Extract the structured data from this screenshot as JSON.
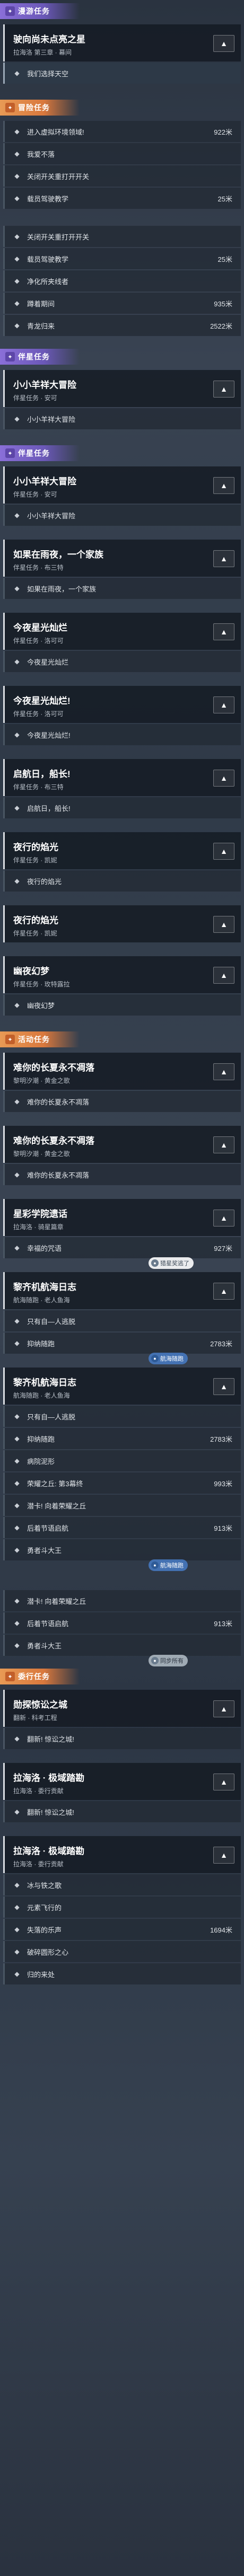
{
  "sections": [
    {
      "type": "section",
      "label": "漫游任务",
      "style": "purple"
    },
    {
      "type": "quest",
      "title": "驶向尚未点亮之星",
      "subtitle": "拉海洛 第三章 · 幕间",
      "sub_rows": [
        {
          "text": "我们选择天空",
          "value": "",
          "state": "sel"
        }
      ]
    },
    {
      "type": "section",
      "label": "冒险任务",
      "style": "orange"
    },
    {
      "type": "rows",
      "items": [
        {
          "text": "进入虚拟环境领域!",
          "value": "922米",
          "state": ""
        },
        {
          "text": "我爱不落",
          "value": "",
          "state": ""
        },
        {
          "text": "关闭开关重打开开关",
          "value": "",
          "state": ""
        },
        {
          "text": "载员驾驶教学",
          "value": "25米",
          "state": ""
        },
        {
          "text": "关闭开关重打开开关",
          "value": "",
          "state": "gap"
        },
        {
          "text": "载员驾驶教学",
          "value": "25米",
          "state": ""
        },
        {
          "text": "净化所夹线者",
          "value": "",
          "state": ""
        },
        {
          "text": "蹲着期间",
          "value": "935米",
          "state": ""
        },
        {
          "text": "青龙归来",
          "value": "2522米",
          "state": ""
        }
      ]
    },
    {
      "type": "section",
      "label": "伴星任务",
      "style": "purple"
    },
    {
      "type": "quest",
      "title": "小小羊祥大冒险",
      "subtitle": "伴星任务 · 安可",
      "sub_rows": [
        {
          "text": "小小羊祥大冒险",
          "value": "",
          "state": ""
        }
      ]
    },
    {
      "type": "section",
      "label": "伴星任务",
      "style": "purple"
    },
    {
      "type": "quest",
      "title": "小小羊祥大冒险",
      "subtitle": "伴星任务 · 安可",
      "sub_rows": [
        {
          "text": "小小羊祥大冒险",
          "value": "",
          "state": ""
        }
      ]
    },
    {
      "type": "quest",
      "title": "如果在雨夜，一个家族",
      "subtitle": "伴星任务 · 布三特",
      "sub_rows": [
        {
          "text": "如果在雨夜，一个家族",
          "value": "",
          "state": ""
        }
      ]
    },
    {
      "type": "quest",
      "title": "今夜星光灿烂",
      "subtitle": "伴星任务 · 洛可可",
      "sub_rows": [
        {
          "text": "今夜星光灿烂",
          "value": "",
          "state": ""
        }
      ]
    },
    {
      "type": "quest",
      "title": "今夜星光灿烂!",
      "subtitle": "伴星任务 · 洛可可",
      "sub_rows": [
        {
          "text": "今夜星光灿烂!",
          "value": "",
          "state": ""
        }
      ]
    },
    {
      "type": "quest",
      "title": "启航日，船长!",
      "subtitle": "伴星任务 · 布三特",
      "sub_rows": [
        {
          "text": "启航日，船长!",
          "value": "",
          "state": ""
        }
      ]
    },
    {
      "type": "quest",
      "title": "夜行的焰光",
      "subtitle": "伴星任务 · 凯妮",
      "sub_rows": [
        {
          "text": "夜行的焰光",
          "value": "",
          "state": ""
        }
      ]
    },
    {
      "type": "quest",
      "title": "夜行的焰光",
      "subtitle": "伴星任务 · 凯妮",
      "sub_rows": []
    },
    {
      "type": "quest",
      "title": "幽夜幻梦",
      "subtitle": "伴星任务 · 玫特露拉",
      "sub_rows": [
        {
          "text": "幽夜幻梦",
          "value": "",
          "state": ""
        }
      ]
    },
    {
      "type": "section",
      "label": "活动任务",
      "style": "orange"
    },
    {
      "type": "quest",
      "title": "难你的长夏永不凋落",
      "subtitle": "黎明汐潮 · 黄金之歌",
      "sub_rows": [
        {
          "text": "难你的长夏永不凋落",
          "value": "",
          "state": ""
        }
      ]
    },
    {
      "type": "quest",
      "title": "难你的长夏永不凋落",
      "subtitle": "黎明汐潮 · 黄金之歌",
      "sub_rows": [
        {
          "text": "难你的长夏永不凋落",
          "value": "",
          "state": ""
        }
      ]
    },
    {
      "type": "quest",
      "title": "星彩学院遗话",
      "subtitle": "拉海洛 · 骑星篇章",
      "sub_rows": [
        {
          "text": "幸福的咒语",
          "value": "927米",
          "state": ""
        }
      ],
      "tags": [
        {
          "text": "猎星奖逃了",
          "color": "white"
        }
      ]
    },
    {
      "type": "quest",
      "title": "黎齐机航海日志",
      "subtitle": "航海随跑 · 老人鱼海",
      "sub_rows": [
        {
          "text": "只有自—人逃脱",
          "value": "",
          "state": ""
        },
        {
          "text": "抑纳随跑",
          "value": "2783米",
          "state": ""
        }
      ],
      "tags": [
        {
          "text": "航海随跑",
          "color": "blue"
        }
      ]
    },
    {
      "type": "quest",
      "title": "黎齐机航海日志",
      "subtitle": "航海随跑 · 老人鱼海",
      "sub_rows": [
        {
          "text": "只有自—人逃脱",
          "value": "",
          "state": ""
        },
        {
          "text": "抑纳随跑",
          "value": "2783米",
          "state": ""
        },
        {
          "text": "病院泥形",
          "value": "",
          "state": ""
        },
        {
          "text": "荣耀之丘: 第3幕终",
          "value": "993米",
          "state": ""
        },
        {
          "text": "潜卡! 向着荣耀之丘",
          "value": "",
          "state": ""
        },
        {
          "text": "后着节语启航",
          "value": "913米",
          "state": ""
        },
        {
          "text": "勇者斗大王",
          "value": "",
          "state": ""
        }
      ],
      "tags": [
        {
          "text": "航海随跑",
          "color": "blue"
        }
      ]
    },
    {
      "type": "rows",
      "items": [
        {
          "text": "潜卡! 向着荣耀之丘",
          "value": "",
          "state": "gap"
        },
        {
          "text": "后着节语启航",
          "value": "913米",
          "state": ""
        },
        {
          "text": "勇者斗大王",
          "value": "",
          "state": ""
        }
      ],
      "tags": [
        {
          "text": "同步所有",
          "color": "grey"
        }
      ]
    },
    {
      "type": "section",
      "label": "委行任务",
      "style": "orange"
    },
    {
      "type": "quest",
      "title": "勋探惊讼之城",
      "subtitle": "翻新 · 科考工程",
      "sub_rows": [
        {
          "text": "翻新! 惊讼之城!",
          "value": "",
          "state": ""
        }
      ]
    },
    {
      "type": "quest",
      "title": "拉海洛 · 极域踏勘",
      "subtitle": "拉海洛 · 委行贡献",
      "sub_rows": [
        {
          "text": "翻新! 惊讼之城!",
          "value": "",
          "state": ""
        }
      ]
    },
    {
      "type": "quest",
      "title": "拉海洛 · 极域踏勘",
      "subtitle": "拉海洛 · 委行贡献",
      "sub_rows": [
        {
          "text": "冰与铁之歌",
          "value": "",
          "state": ""
        },
        {
          "text": "元素飞行的",
          "value": "",
          "state": ""
        },
        {
          "text": "失落的乐声",
          "value": "1694米",
          "state": ""
        },
        {
          "text": "破碎圆形之心",
          "value": "",
          "state": ""
        },
        {
          "text": "归的来处",
          "value": "",
          "state": ""
        }
      ]
    }
  ]
}
